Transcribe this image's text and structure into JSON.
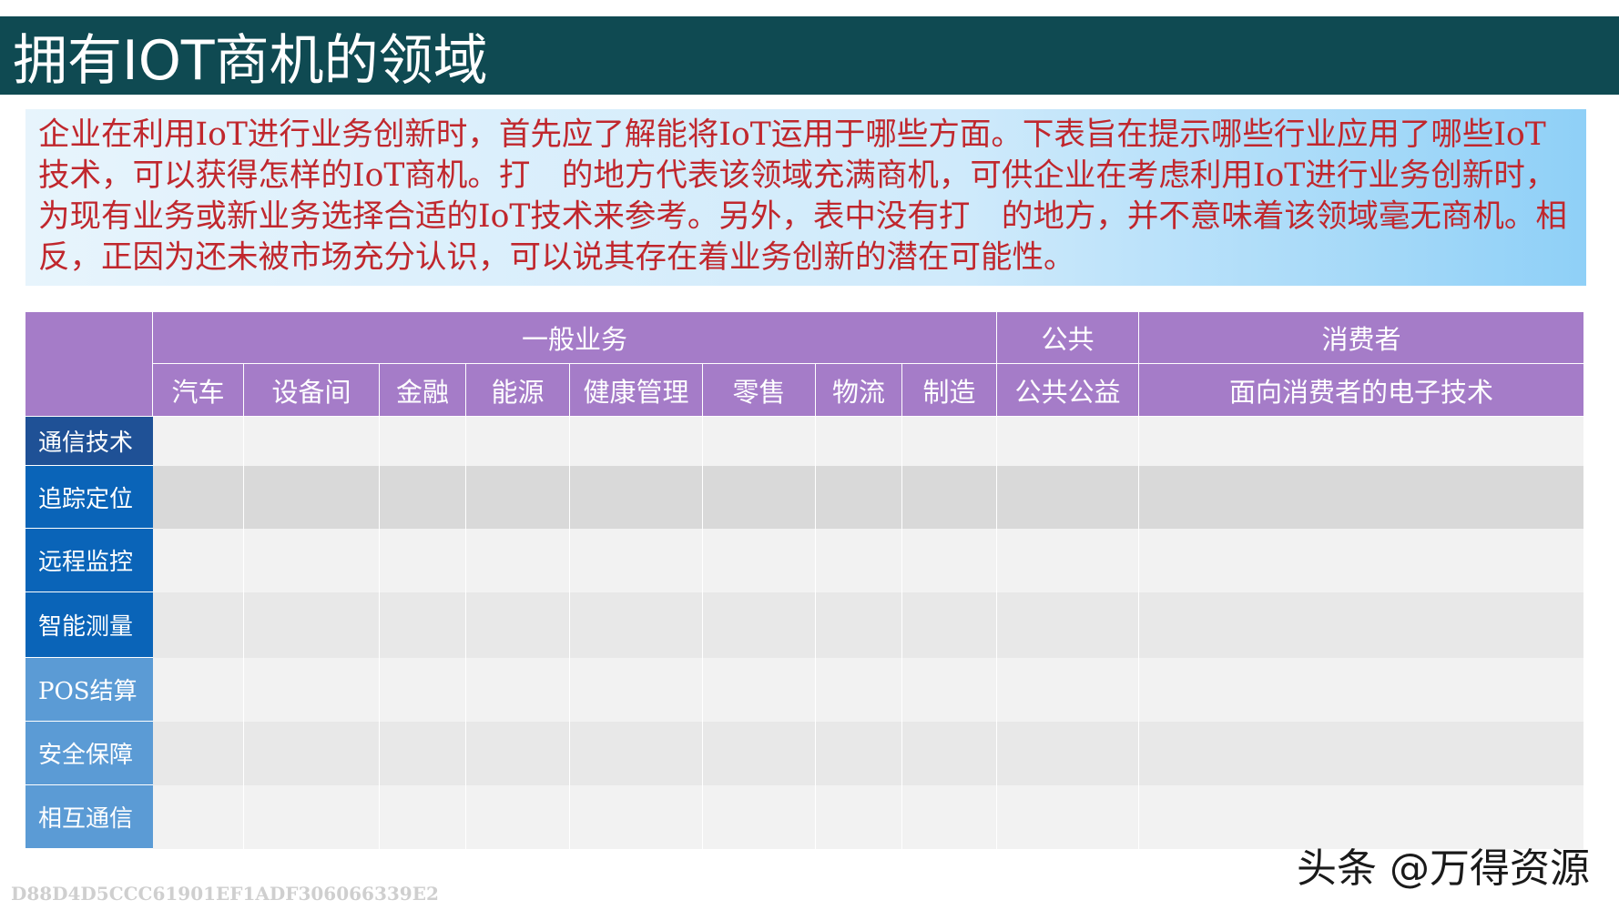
{
  "slide": {
    "title": "拥有IOT商机的领域",
    "intro": "企业在利用IoT进行业务创新时，首先应了解能将IoT运用于哪些方面。下表旨在提示哪些行业应用了哪些IoT技术，可以获得怎样的IoT商机。打　的地方代表该领域充满商机，可供企业在考虑利用IoT进行业务创新时，为现有业务或新业务选择合适的IoT技术来参考。另外，表中没有打　的地方，并不意味着该领域毫无商机。相反，正因为还未被市场充分认识，可以说其存在着业务创新的潜在可能性。"
  },
  "table": {
    "groups": [
      "一般业务",
      "公共",
      "消费者"
    ],
    "columns": [
      "汽车",
      "设备间",
      "金融",
      "能源",
      "健康管理",
      "零售",
      "物流",
      "制造",
      "公共公益",
      "面向消费者的电子技术"
    ],
    "rows": [
      "通信技术",
      "追踪定位",
      "远程监控",
      "智能测量",
      "POS结算",
      "安全保障",
      "相互通信"
    ],
    "colors": {
      "header": "#a57cc8",
      "row_header_dark": "#1f5196",
      "row_header_mid": "#0a64b8",
      "row_header_light": "#5b9bd5",
      "row_light": "#f2f2f2",
      "row_dark": "#d9d9d9",
      "row_mid": "#e8e8e8"
    }
  },
  "watermark": "头条 @万得资源",
  "doc_hash": "D88D4D5CCC61901EF1ADF306066339E2"
}
